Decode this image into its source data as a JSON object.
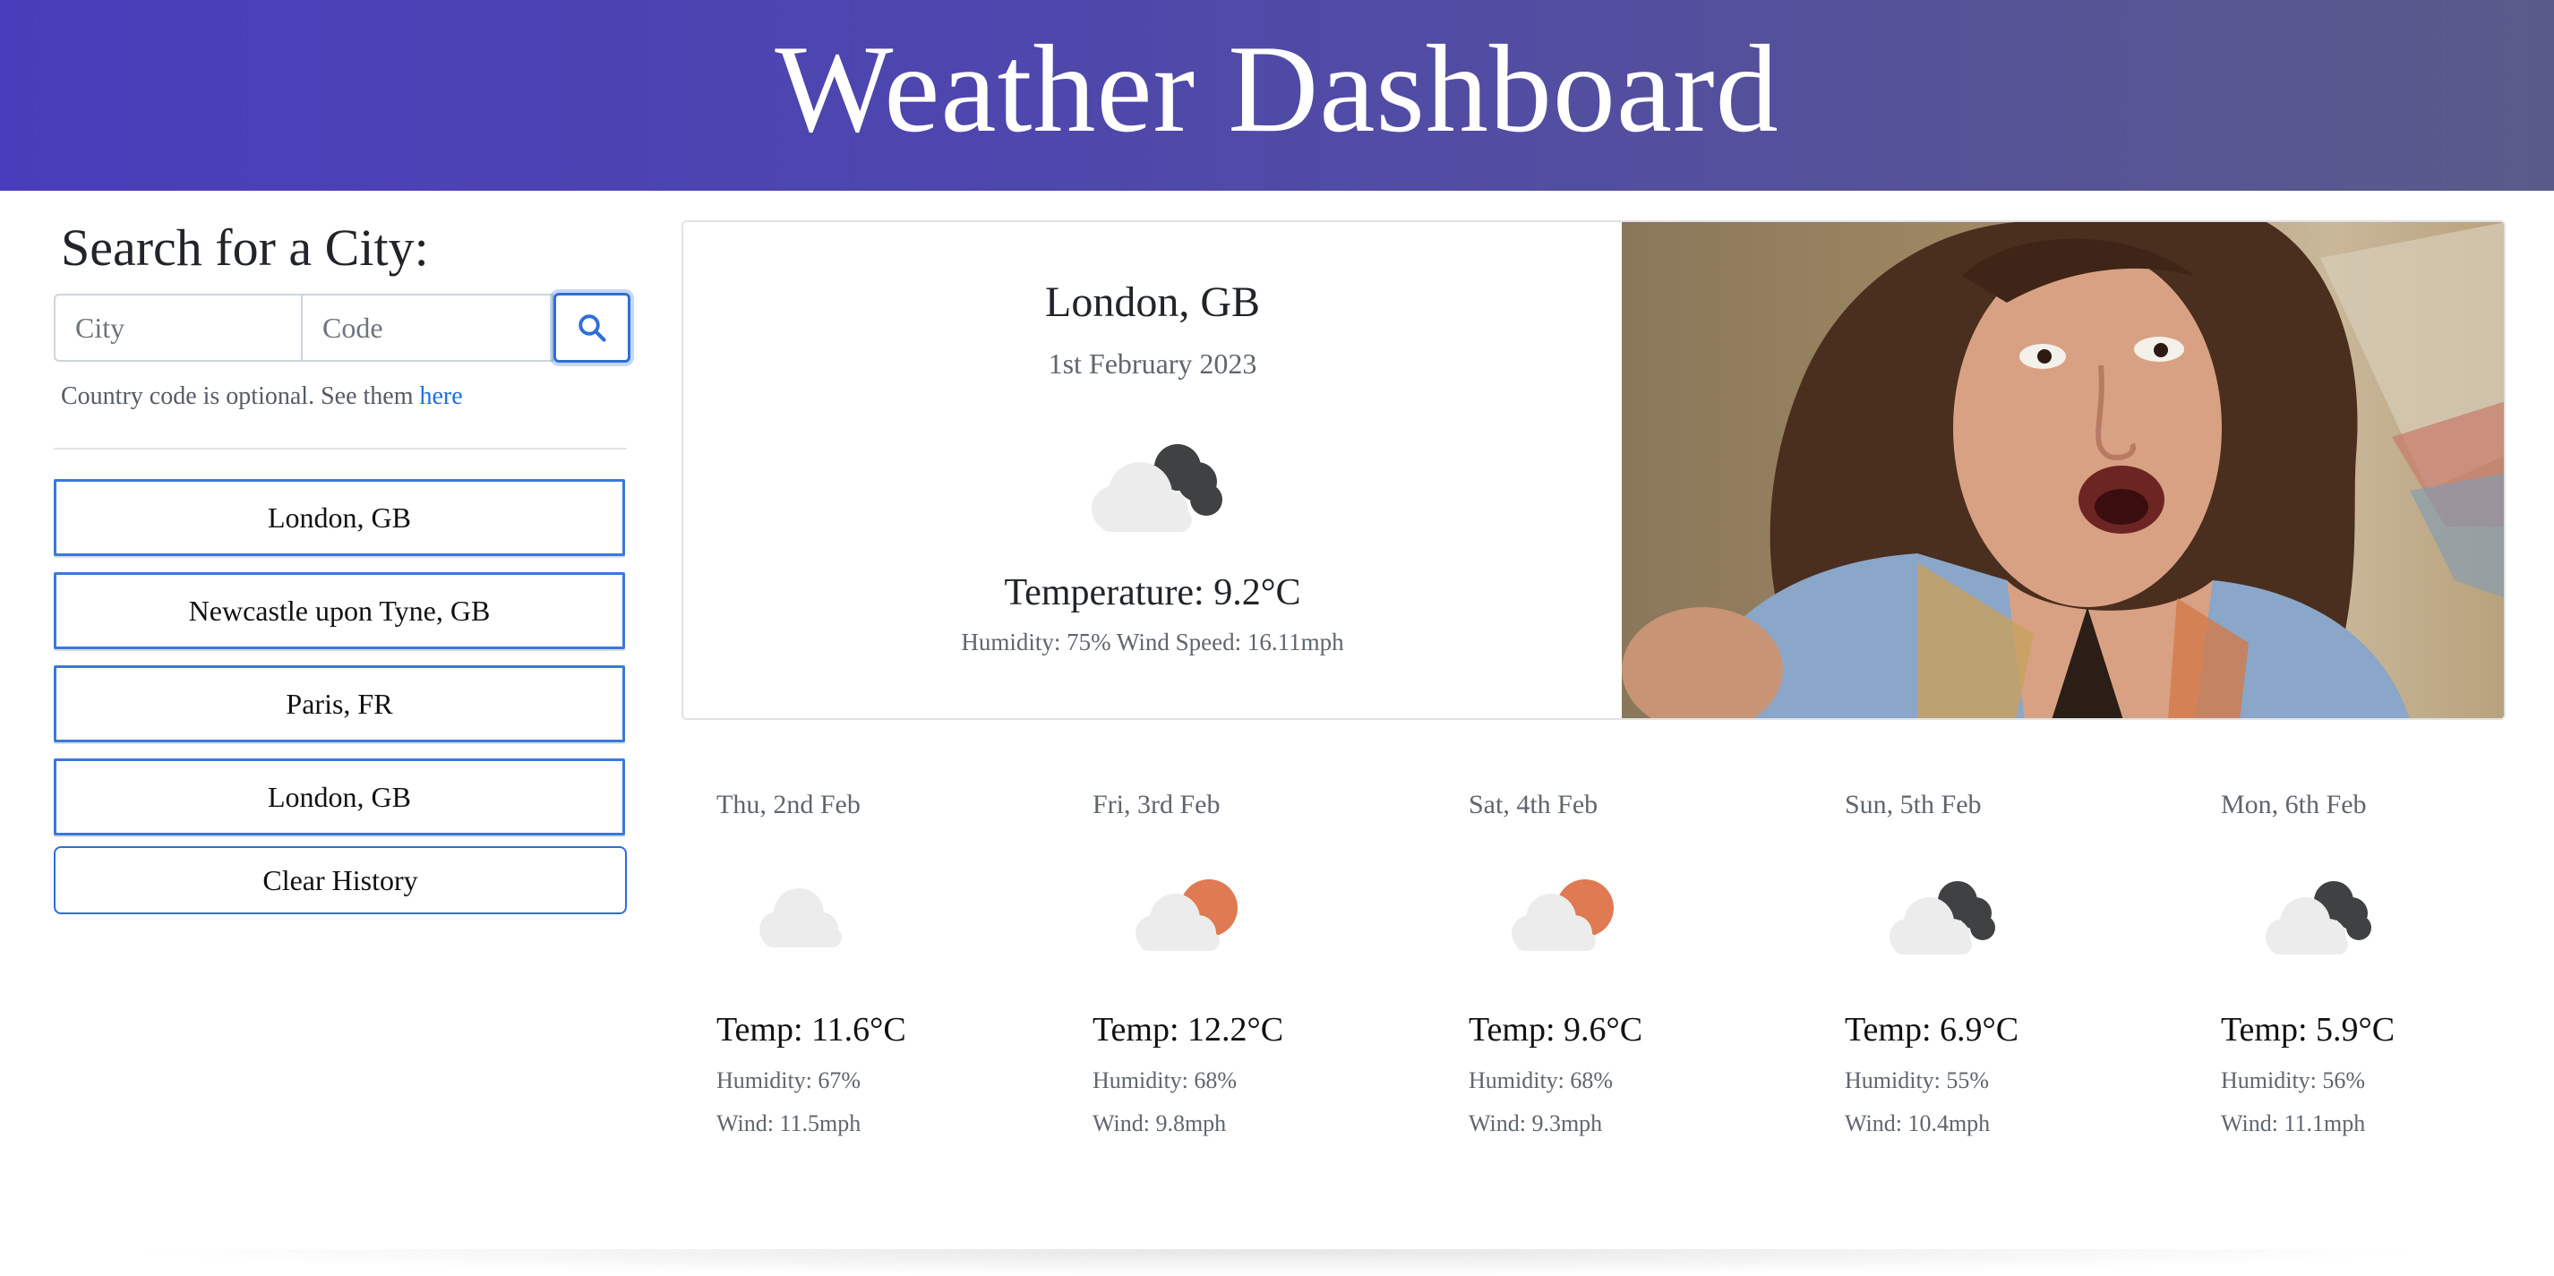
{
  "header": {
    "title": "Weather Dashboard"
  },
  "sidebar": {
    "title": "Search for a City:",
    "city_placeholder": "City",
    "code_placeholder": "Code",
    "search_icon": "search-icon",
    "hint_text": "Country code is optional. See them ",
    "hint_link": "here",
    "history": [
      {
        "label": "London, GB"
      },
      {
        "label": "Newcastle upon Tyne, GB"
      },
      {
        "label": "Paris, FR"
      },
      {
        "label": "London, GB"
      }
    ],
    "clear_label": "Clear History"
  },
  "current": {
    "city": "London, GB",
    "date": "1st February 2023",
    "icon": "broken-clouds-icon",
    "temperature": "Temperature: 9.2°C",
    "details": "Humidity: 75% Wind Speed: 16.11mph",
    "image": "reaction-gif"
  },
  "forecast": [
    {
      "date": "Thu, 2nd Feb",
      "icon": "cloud-icon",
      "temp": "Temp: 11.6°C",
      "humidity": "Humidity: 67%",
      "wind": "Wind: 11.5mph"
    },
    {
      "date": "Fri, 3rd Feb",
      "icon": "cloud-sun-icon",
      "temp": "Temp: 12.2°C",
      "humidity": "Humidity: 68%",
      "wind": "Wind: 9.8mph"
    },
    {
      "date": "Sat, 4th Feb",
      "icon": "cloud-sun-icon",
      "temp": "Temp: 9.6°C",
      "humidity": "Humidity: 68%",
      "wind": "Wind: 9.3mph"
    },
    {
      "date": "Sun, 5th Feb",
      "icon": "broken-clouds-icon",
      "temp": "Temp: 6.9°C",
      "humidity": "Humidity: 55%",
      "wind": "Wind: 10.4mph"
    },
    {
      "date": "Mon, 6th Feb",
      "icon": "broken-clouds-icon",
      "temp": "Temp: 5.9°C",
      "humidity": "Humidity: 56%",
      "wind": "Wind: 11.1mph"
    }
  ],
  "colors": {
    "header_start": "#4a3dbb",
    "header_end": "#5a5a8a",
    "accent": "#2f6ed6",
    "sun": "#e07a52",
    "dark_cloud": "#3f4143",
    "light_cloud": "#ececec"
  }
}
